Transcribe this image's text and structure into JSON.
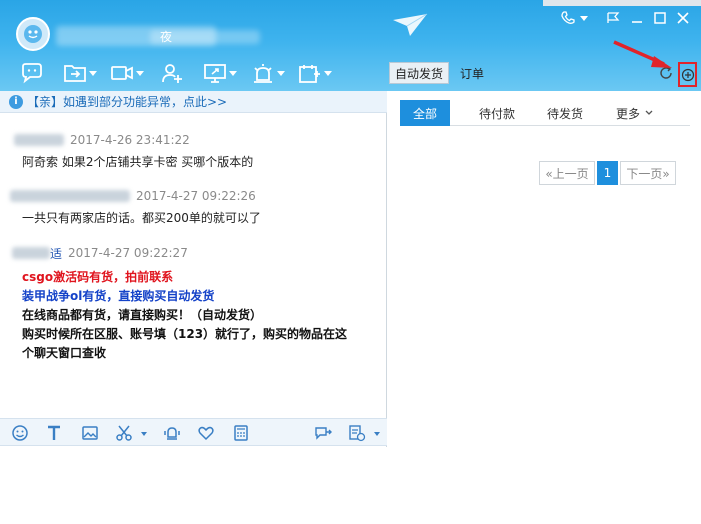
{
  "header": {
    "title_visible_fragment": "夜",
    "tabs": {
      "auto_ship": "自动发货",
      "orders": "订单"
    }
  },
  "icons": {
    "avatar": "avatar-icon",
    "plane": "paper-plane-icon",
    "phone": "phone-icon",
    "flag": "flag-icon",
    "minimize": "minimize-icon",
    "maximize": "maximize-icon",
    "close": "close-icon"
  },
  "notice": {
    "text": "【亲】如遇到部分功能异常，点此>>"
  },
  "messages": [
    {
      "time": "2017-4-26 23:41:22",
      "lines": [
        "阿奇索  如果2个店铺共享卡密 买哪个版本的"
      ]
    },
    {
      "time": "2017-4-27 09:22:26",
      "lines": [
        "一共只有两家店的话。都买200单的就可以了"
      ]
    },
    {
      "time": "2017-4-27 09:22:27",
      "name_fragment": "适",
      "red_line": "csgo激活码有货，拍前联系",
      "blue_line": "装甲战争ol有货，直接购买自动发货",
      "black_lines": [
        "在线商品都有货，请直接购买！（自动发货）",
        "购买时候所在区服、账号填（123）就行了，购买的物品在这",
        "个聊天窗口查收"
      ]
    }
  ],
  "right": {
    "tabs": [
      "全部",
      "待付款",
      "待发货",
      "更多"
    ],
    "pager": {
      "prev": "«上一页",
      "current": "1",
      "next": "下一页»"
    }
  },
  "colors": {
    "header_top": "#2aa5e6",
    "accent": "#1e8fdd",
    "red_text": "#e0141e",
    "blue_text": "#1442c8",
    "annotation": "#e0242b"
  }
}
